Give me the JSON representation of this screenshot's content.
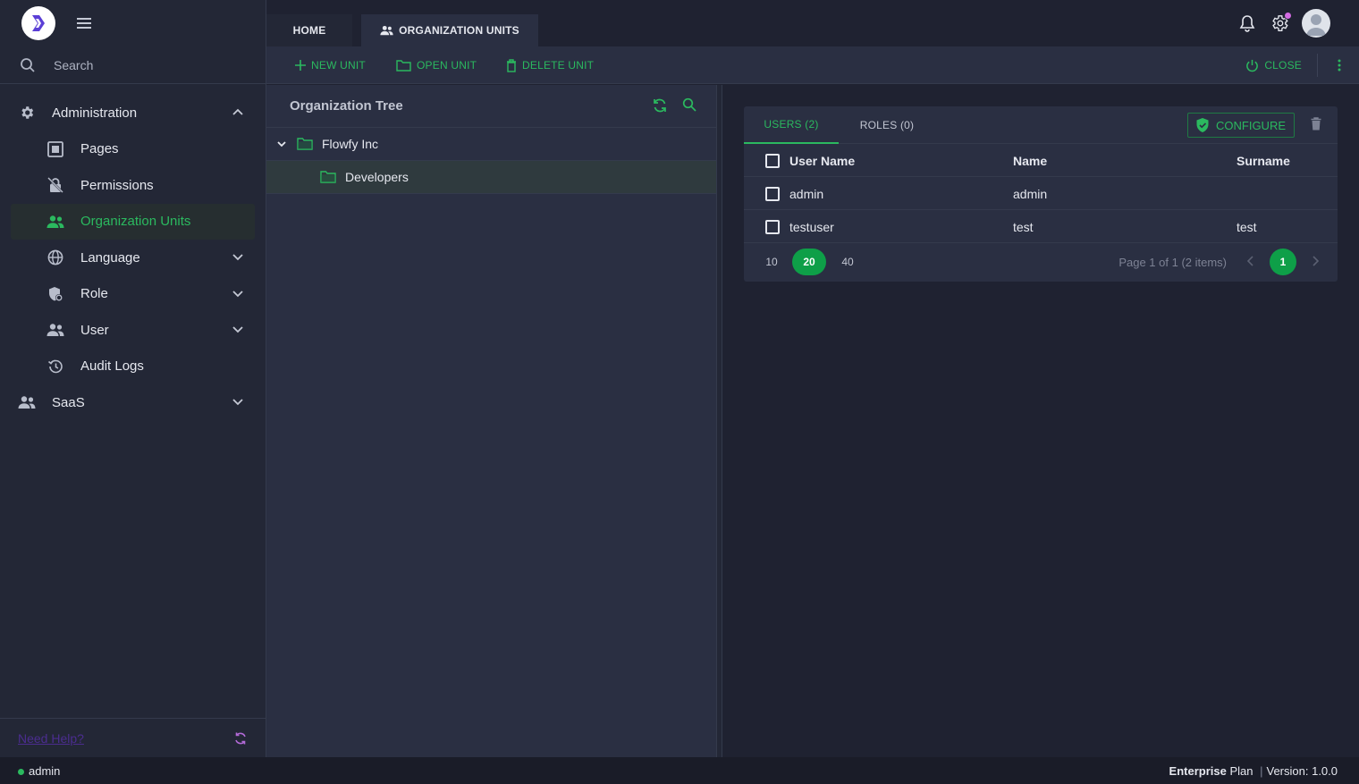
{
  "sidebar": {
    "search_placeholder": "Search",
    "items": [
      {
        "label": "Administration",
        "icon": "gear-icon",
        "expanded": true
      },
      {
        "label": "Pages",
        "icon": "pages-icon"
      },
      {
        "label": "Permissions",
        "icon": "permissions-icon"
      },
      {
        "label": "Organization Units",
        "icon": "people-icon",
        "active": true
      },
      {
        "label": "Language",
        "icon": "globe-icon"
      },
      {
        "label": "Role",
        "icon": "role-shield-icon"
      },
      {
        "label": "User",
        "icon": "users-icon"
      },
      {
        "label": "Audit Logs",
        "icon": "history-icon"
      },
      {
        "label": "SaaS",
        "icon": "saas-icon"
      }
    ],
    "help_link": "Need Help?"
  },
  "tabs": {
    "home": "HOME",
    "org_units": "ORGANIZATION UNITS"
  },
  "toolbar": {
    "new_unit": "NEW UNIT",
    "open_unit": "OPEN UNIT",
    "delete_unit": "DELETE UNIT",
    "close": "CLOSE"
  },
  "tree": {
    "title": "Organization Tree",
    "root": "Flowfy Inc",
    "child": "Developers"
  },
  "members": {
    "tab_users": "USERS (2)",
    "tab_roles": "ROLES (0)",
    "configure": "CONFIGURE",
    "columns": [
      "User Name",
      "Name",
      "Surname"
    ],
    "rows": [
      {
        "username": "admin",
        "name": "admin",
        "surname": ""
      },
      {
        "username": "testuser",
        "name": "test",
        "surname": "test"
      }
    ],
    "page_sizes": [
      "10",
      "20",
      "40"
    ],
    "selected_page_size": "20",
    "page_info": "Page 1 of 1 (2 items)",
    "current_page": "1"
  },
  "footer": {
    "user": "admin",
    "plan_bold": "Enterprise",
    "plan_rest": " Plan",
    "version": "Version: 1.0.0"
  },
  "colors": {
    "accent": "#2bb95f",
    "background": "#1f2231",
    "panel": "#2a2f42"
  }
}
